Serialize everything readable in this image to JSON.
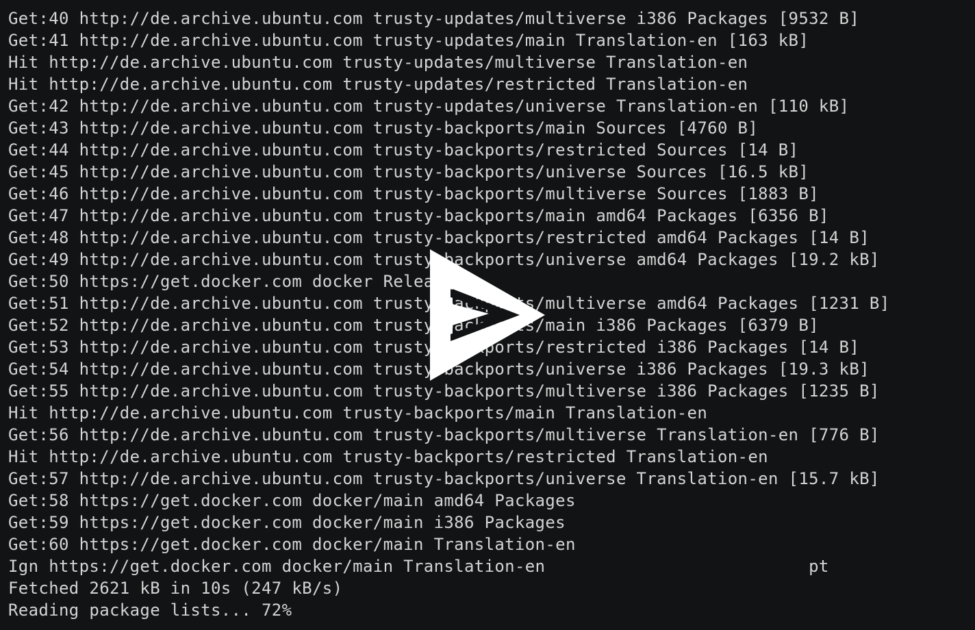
{
  "terminal": {
    "lines": [
      "Get:40 http://de.archive.ubuntu.com trusty-updates/multiverse i386 Packages [9532 B]",
      "Get:41 http://de.archive.ubuntu.com trusty-updates/main Translation-en [163 kB]",
      "Hit http://de.archive.ubuntu.com trusty-updates/multiverse Translation-en",
      "Hit http://de.archive.ubuntu.com trusty-updates/restricted Translation-en",
      "Get:42 http://de.archive.ubuntu.com trusty-updates/universe Translation-en [110 kB]",
      "Get:43 http://de.archive.ubuntu.com trusty-backports/main Sources [4760 B]",
      "Get:44 http://de.archive.ubuntu.com trusty-backports/restricted Sources [14 B]",
      "Get:45 http://de.archive.ubuntu.com trusty-backports/universe Sources [16.5 kB]",
      "Get:46 http://de.archive.ubuntu.com trusty-backports/multiverse Sources [1883 B]",
      "Get:47 http://de.archive.ubuntu.com trusty-backports/main amd64 Packages [6356 B]",
      "Get:48 http://de.archive.ubuntu.com trusty-backports/restricted amd64 Packages [14 B]",
      "Get:49 http://de.archive.ubuntu.com trusty-backports/universe amd64 Packages [19.2 kB]",
      "Get:50 https://get.docker.com docker Release",
      "Get:51 http://de.archive.ubuntu.com trusty-backports/multiverse amd64 Packages [1231 B]",
      "Get:52 http://de.archive.ubuntu.com trusty-backports/main i386 Packages [6379 B]",
      "Get:53 http://de.archive.ubuntu.com trusty-backports/restricted i386 Packages [14 B]",
      "Get:54 http://de.archive.ubuntu.com trusty-backports/universe i386 Packages [19.3 kB]",
      "Get:55 http://de.archive.ubuntu.com trusty-backports/multiverse i386 Packages [1235 B]",
      "Hit http://de.archive.ubuntu.com trusty-backports/main Translation-en",
      "Get:56 http://de.archive.ubuntu.com trusty-backports/multiverse Translation-en [776 B]",
      "Hit http://de.archive.ubuntu.com trusty-backports/restricted Translation-en",
      "Get:57 http://de.archive.ubuntu.com trusty-backports/universe Translation-en [15.7 kB]",
      "Get:58 https://get.docker.com docker/main amd64 Packages",
      "Get:59 https://get.docker.com docker/main i386 Packages",
      "Get:60 https://get.docker.com docker/main Translation-en",
      "Ign https://get.docker.com docker/main Translation-en                          pt",
      "Fetched 2621 kB in 10s (247 kB/s)",
      "Reading package lists... 72%"
    ]
  },
  "overlay": {
    "icon": "play-icon",
    "color": "#ffffff"
  },
  "colors": {
    "background": "#121314",
    "foreground": "#d4d4d4"
  }
}
